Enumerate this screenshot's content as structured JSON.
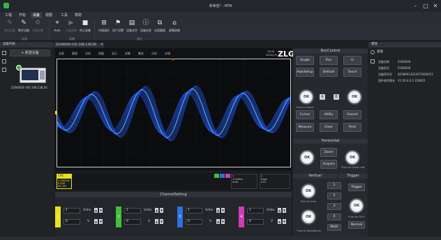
{
  "window": {
    "title": "未命名* - MTA",
    "min": "–",
    "max": "□",
    "close": "✕"
  },
  "menu": [
    "工程",
    "开始",
    "设备",
    "视图",
    "工具",
    "帮助"
  ],
  "ribbon": {
    "buttons": [
      {
        "label": "添加设备",
        "icon": "✎"
      },
      {
        "label": "断开设备",
        "icon": "✎"
      },
      {
        "label": "设备设置",
        "icon": "⚙"
      },
      {
        "label": "Auto",
        "icon": "⌖"
      },
      {
        "label": "开始采集",
        "icon": "▶"
      },
      {
        "label": "停止采集",
        "icon": "■"
      },
      {
        "label": "扫描波形",
        "icon": "⊞"
      },
      {
        "label": "用户设置",
        "icon": "⚑"
      },
      {
        "label": "设备文件",
        "icon": "▤"
      },
      {
        "label": "设备信息",
        "icon": "ⓘ"
      },
      {
        "label": "远程截图",
        "icon": "⧉"
      },
      {
        "label": "屏幕录像",
        "icon": "⌂"
      }
    ],
    "groups": [
      "连接",
      "采集",
      "其它"
    ]
  },
  "left_panel": {
    "title": "设备列表",
    "add_button": "+ 新建设备",
    "device_label": "ZUS6000-192.168.138.56"
  },
  "tab": {
    "label": "ZUS6000-192.168.138.56",
    "close": "×"
  },
  "scope": {
    "toolbar": [
      "全屏",
      "截图",
      "光标",
      "测量",
      "显示",
      "采集",
      "触发",
      "分析",
      "存储"
    ],
    "brand": "ZLG",
    "clock": "16:35",
    "date": "2024/1/3",
    "channel_label": "CH1",
    "ch_info": [
      "1.00V/div",
      "0.00V",
      "DC 1M"
    ],
    "timebase": [
      "T",
      "1.000ms",
      "Auto"
    ],
    "trigger": [
      "F",
      "Edge",
      "CH1"
    ]
  },
  "run_control": {
    "title": "RunControl",
    "buttons": [
      "Single",
      "Run",
      "G",
      "AutoSetup",
      "Default",
      "Touch"
    ],
    "knob": "OK",
    "ab": [
      "A",
      "B"
    ],
    "push_select": "Push to Select",
    "func": [
      "Cursor",
      "Utility",
      "Search",
      "Measure",
      "Clear",
      "Print"
    ]
  },
  "horizontal": {
    "title": "Horizontal",
    "zoom": "Zoom",
    "acquire": "Acquire",
    "push_center": "Push to Center Left"
  },
  "vertical": {
    "title": "Vertical",
    "push_fine": "Push for Fine",
    "push_zero": "Push to Zero/Return",
    "ch": [
      "1",
      "2",
      "3",
      "4"
    ],
    "math": "Math"
  },
  "trigger_panel": {
    "title": "Trigger",
    "trigger": "Trigger",
    "push_50": "Push for 50%",
    "normal": "Normal"
  },
  "channel_setting": {
    "title": "ChannelSetting",
    "channels": [
      {
        "id": "1",
        "color": "#e9e020",
        "scale": "1",
        "offset": "0",
        "unit": "V/div",
        "unit2": "V"
      },
      {
        "id": "2",
        "color": "#3fbf3a",
        "scale": "1",
        "offset": "0",
        "unit": "V/div",
        "unit2": "V"
      },
      {
        "id": "3",
        "color": "#2f6fe0",
        "scale": "1",
        "offset": "0",
        "unit": "V/div",
        "unit2": "V"
      },
      {
        "id": "4",
        "color": "#d23bb7",
        "scale": "1",
        "offset": "0",
        "unit": "V/div",
        "unit2": "V"
      }
    ]
  },
  "properties": {
    "title": "属性",
    "section": "基础",
    "rows": [
      {
        "k": "设备名称",
        "v": "ZUS6000"
      },
      {
        "k": "设备型号",
        "v": "ZUS6000"
      },
      {
        "k": "设备序列号",
        "v": "82089013022072000011"
      },
      {
        "k": "固件软件版本",
        "v": "V1.00.4.0.2.220831"
      }
    ]
  },
  "colors": {
    "wave": "#2a5cff",
    "wave_core": "#5fd0ff",
    "brand": "#ffffff",
    "accent": "#2fb84a"
  }
}
